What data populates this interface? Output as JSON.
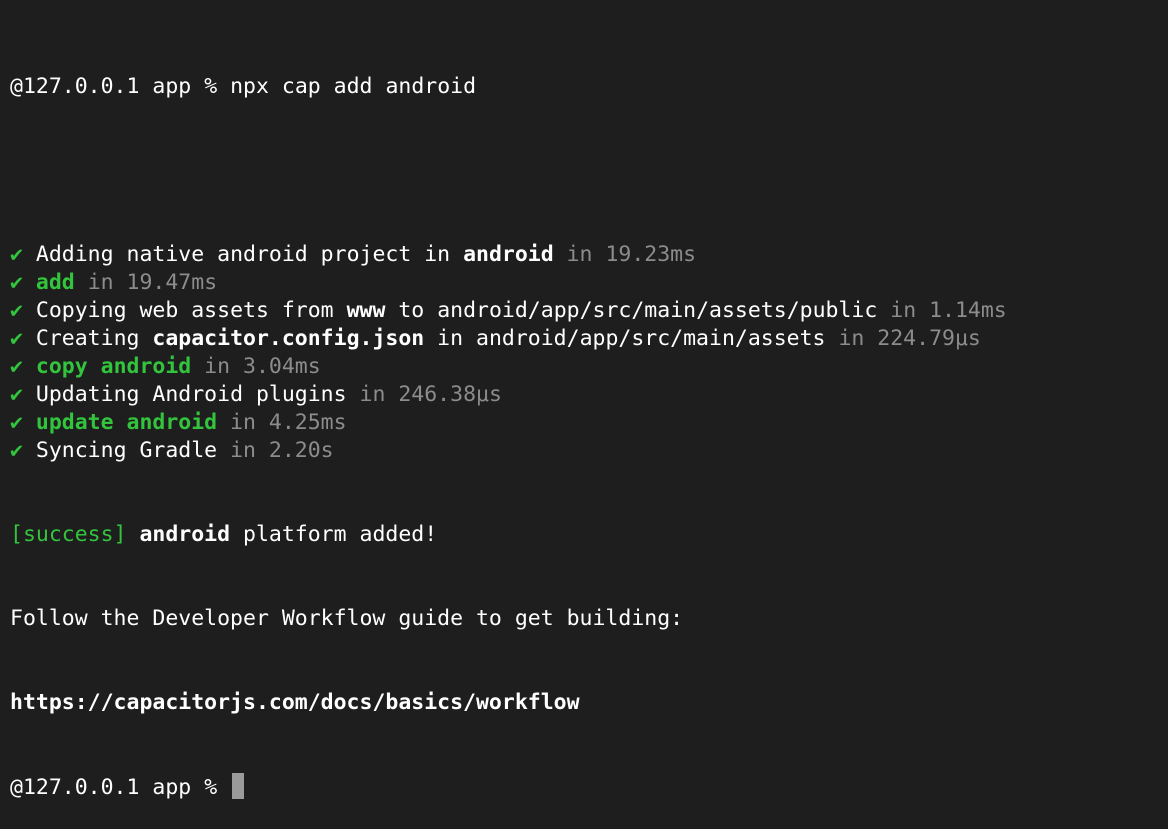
{
  "prompt": {
    "user_host": "@127.0.0.1",
    "dir": "app",
    "symbol": "%"
  },
  "command": "npx cap add android",
  "check_mark": "✔",
  "steps": [
    {
      "segments": [
        {
          "text": "Adding native android project in "
        },
        {
          "text": "android",
          "style": "bold"
        },
        {
          "text": " in 19.23ms",
          "style": "dim"
        }
      ]
    },
    {
      "segments": [
        {
          "text": "add",
          "style": "green-bold"
        },
        {
          "text": " in 19.47ms",
          "style": "dim"
        }
      ]
    },
    {
      "segments": [
        {
          "text": "Copying web assets from "
        },
        {
          "text": "www",
          "style": "bold"
        },
        {
          "text": " to android/app/src/main/assets/public"
        },
        {
          "text": " in 1.14ms",
          "style": "dim"
        }
      ]
    },
    {
      "segments": [
        {
          "text": "Creating "
        },
        {
          "text": "capacitor.config.json",
          "style": "bold"
        },
        {
          "text": " in android/app/src/main/assets"
        },
        {
          "text": " in 224.79μs",
          "style": "dim"
        }
      ]
    },
    {
      "segments": [
        {
          "text": "copy android",
          "style": "green-bold"
        },
        {
          "text": " in 3.04ms",
          "style": "dim"
        }
      ]
    },
    {
      "segments": [
        {
          "text": "Updating Android plugins"
        },
        {
          "text": " in 246.38μs",
          "style": "dim"
        }
      ]
    },
    {
      "segments": [
        {
          "text": "update android",
          "style": "green-bold"
        },
        {
          "text": " in 4.25ms",
          "style": "dim"
        }
      ]
    },
    {
      "segments": [
        {
          "text": "Syncing Gradle"
        },
        {
          "text": " in 2.20s",
          "style": "dim"
        }
      ]
    }
  ],
  "success": {
    "tag": "[success]",
    "platform": "android",
    "message": "platform added!"
  },
  "follow_text": "Follow the Developer Workflow guide to get building:",
  "workflow_url": "https://capacitorjs.com/docs/basics/workflow"
}
